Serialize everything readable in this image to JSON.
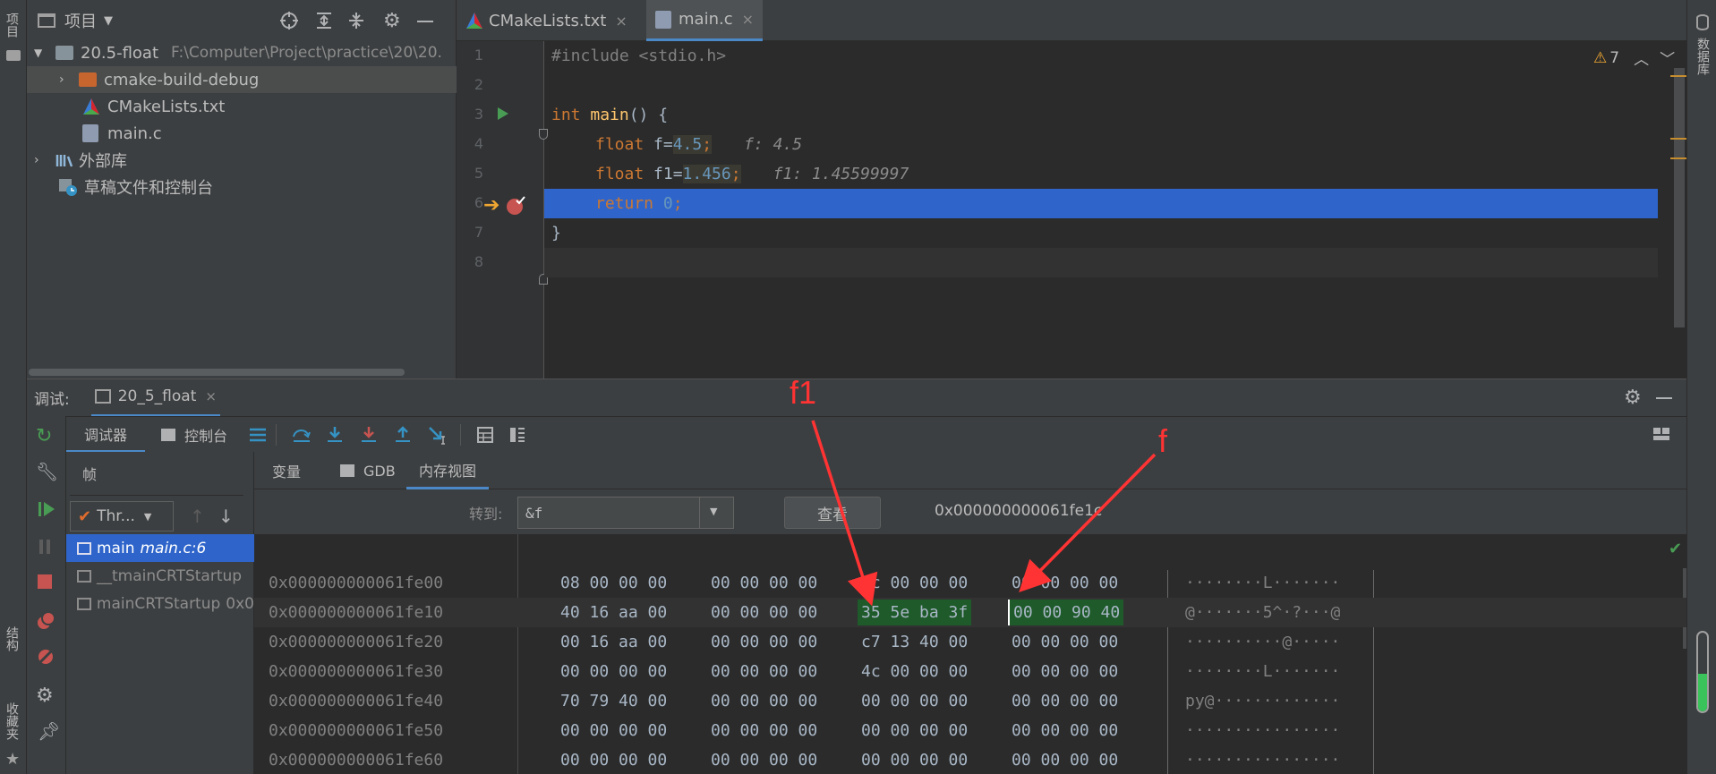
{
  "project_panel": {
    "title": "项目",
    "tree": [
      {
        "label": "20.5-float",
        "path": "F:\\Computer\\Project\\practice\\20\\20."
      },
      {
        "label": "cmake-build-debug"
      },
      {
        "label": "CMakeLists.txt"
      },
      {
        "label": "main.c"
      },
      {
        "label": "外部库"
      },
      {
        "label": "草稿文件和控制台"
      }
    ]
  },
  "left_strip": {
    "project": "项目",
    "structure": "结构",
    "favorites": "收藏夹"
  },
  "right_strip": {
    "database": "数据库"
  },
  "editor": {
    "tabs": [
      {
        "label": "CMakeLists.txt"
      },
      {
        "label": "main.c"
      }
    ],
    "warnings": "7",
    "line_numbers": [
      "1",
      "2",
      "3",
      "4",
      "5",
      "6",
      "7",
      "8"
    ],
    "lines": {
      "l1_directive": "#include",
      "l1_header": " <stdio.h>",
      "l3_kw": "int",
      "l3_fn": " main",
      "l3_rest": "() {",
      "l4_kw": "float",
      "l4_var": " f=",
      "l4_num": "4.5",
      "l4_semi": ";",
      "l4_hint": "f: 4.5",
      "l5_kw": "float",
      "l5_var": " f1=",
      "l5_num": "1.456",
      "l5_semi": ";",
      "l5_hint": "f1: 1.45599997",
      "l6_kw": "return",
      "l6_num": " 0",
      "l6_semi": ";",
      "l7_brace": "}"
    }
  },
  "debug": {
    "label": "调试:",
    "config_tab": "20_5_float",
    "tabs": {
      "debugger": "调试器",
      "console": "控制台"
    },
    "frames_label": "帧",
    "thread_select": "Thr...",
    "frames": [
      {
        "name": "main",
        "location": "main.c:6"
      },
      {
        "name": "__tmainCRTStartup",
        "location": ""
      },
      {
        "name": "mainCRTStartup",
        "location": "0x0"
      }
    ],
    "subtabs": {
      "variables": "变量",
      "gdb": "GDB",
      "memory": "内存视图"
    },
    "goto_label": "转到:",
    "goto_value": "&f",
    "view_button": "查看",
    "address_value": "0x000000000061fe1c",
    "memory_rows": [
      {
        "addr": "0x000000000061fe00",
        "g1": "08 00 00 00",
        "g2": "00 00 00 00",
        "g3": "4c 00 00 00",
        "g4": "00 00 00 00",
        "ascii": "········L·······"
      },
      {
        "addr": "0x000000000061fe10",
        "g1": "40 16 aa 00",
        "g2": "00 00 00 00",
        "g3": "35 5e ba 3f",
        "g4": "00 00 90 40",
        "ascii": "@·······5^·?···@"
      },
      {
        "addr": "0x000000000061fe20",
        "g1": "00 16 aa 00",
        "g2": "00 00 00 00",
        "g3": "c7 13 40 00",
        "g4": "00 00 00 00",
        "ascii": "··········@·····"
      },
      {
        "addr": "0x000000000061fe30",
        "g1": "00 00 00 00",
        "g2": "00 00 00 00",
        "g3": "4c 00 00 00",
        "g4": "00 00 00 00",
        "ascii": "········L·······"
      },
      {
        "addr": "0x000000000061fe40",
        "g1": "70 79 40 00",
        "g2": "00 00 00 00",
        "g3": "00 00 00 00",
        "g4": "00 00 00 00",
        "ascii": "py@·············"
      },
      {
        "addr": "0x000000000061fe50",
        "g1": "00 00 00 00",
        "g2": "00 00 00 00",
        "g3": "00 00 00 00",
        "g4": "00 00 00 00",
        "ascii": "················"
      },
      {
        "addr": "0x000000000061fe60",
        "g1": "00 00 00 00",
        "g2": "00 00 00 00",
        "g3": "00 00 00 00",
        "g4": "00 00 00 00",
        "ascii": "················"
      }
    ]
  },
  "annotations": {
    "f1": "f1",
    "f": "f"
  },
  "colors": {
    "accent": "#4a88c7",
    "selection": "#2f65ca",
    "highlight_green": "#1e5a2a",
    "annotation_red": "#ff3333",
    "breakpoint": "#c75450"
  }
}
